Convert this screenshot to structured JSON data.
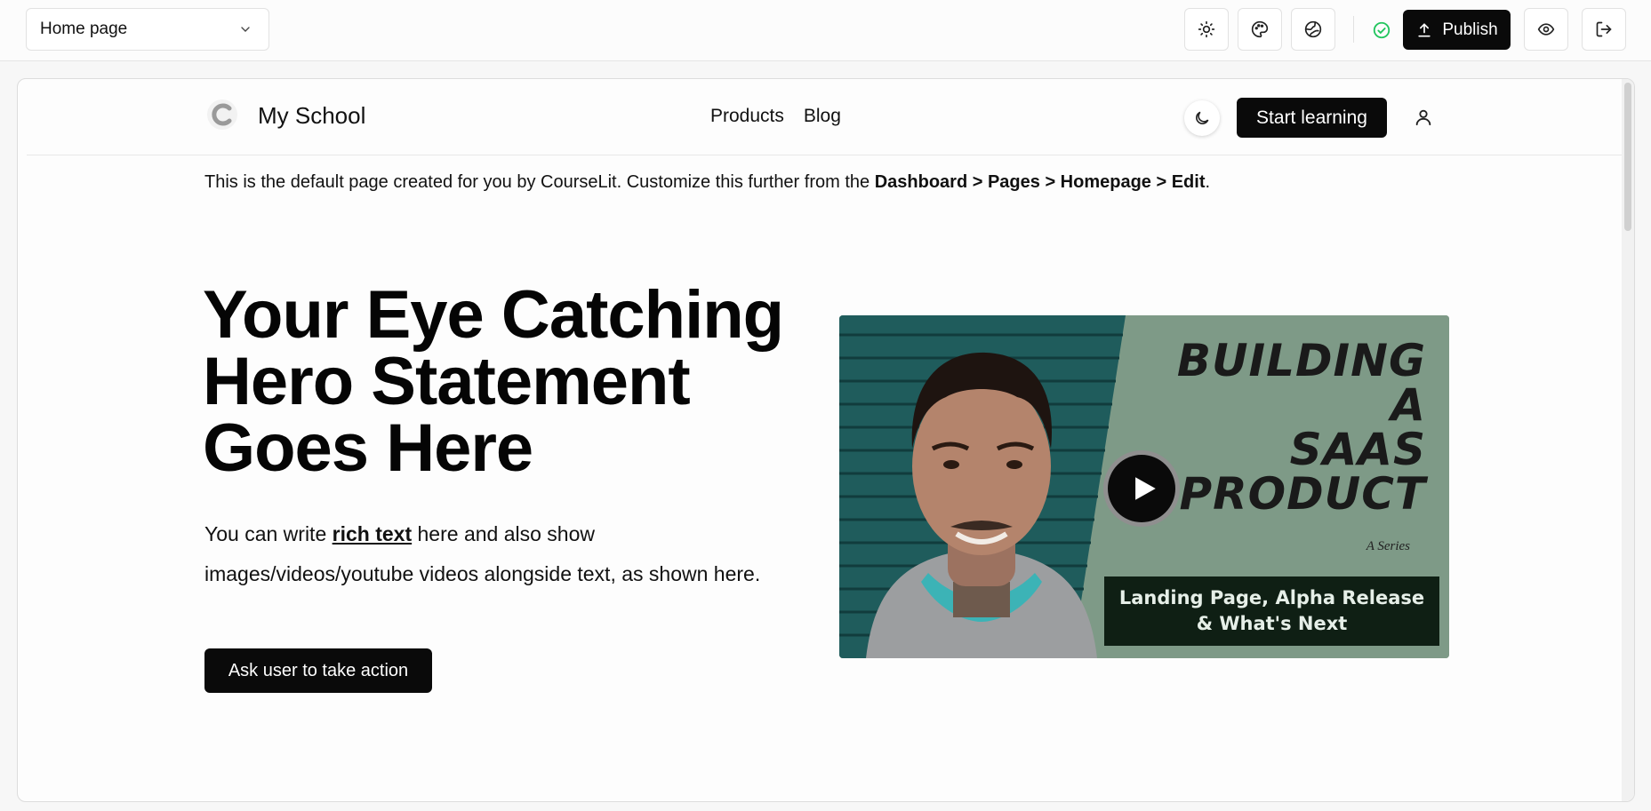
{
  "editor": {
    "page_selector": {
      "value": "Home page"
    },
    "toolbar": {
      "status_icon": "check-circle-icon",
      "publish_label": "Publish",
      "icons": [
        "sun-icon",
        "palette-icon",
        "globe-icon",
        "eye-icon",
        "logout-icon"
      ]
    }
  },
  "site": {
    "brand": "My School",
    "nav": [
      "Products",
      "Blog"
    ],
    "start_button": "Start learning"
  },
  "notice": {
    "prefix": "This is the default page created for you by CourseLit. Customize this further from the ",
    "path": "Dashboard > Pages > Homepage > Edit",
    "suffix": "."
  },
  "hero": {
    "title": "Your Eye Catching Hero Statement Goes Here",
    "text_before": "You can write ",
    "text_bold": "rich text",
    "text_after": " here and also show images/videos/youtube videos alongside text, as shown here.",
    "cta": "Ask user to take action"
  },
  "video": {
    "title_lines": [
      "BUILDING",
      "A",
      "SAAS",
      "PRODUCT"
    ],
    "series": "A Series",
    "caption_lines": [
      "Landing Page, Alpha Release",
      "& What's Next"
    ]
  },
  "colors": {
    "accent": "#0a0a0a",
    "success": "#22c55e",
    "video_bg": "#7e9a87"
  }
}
